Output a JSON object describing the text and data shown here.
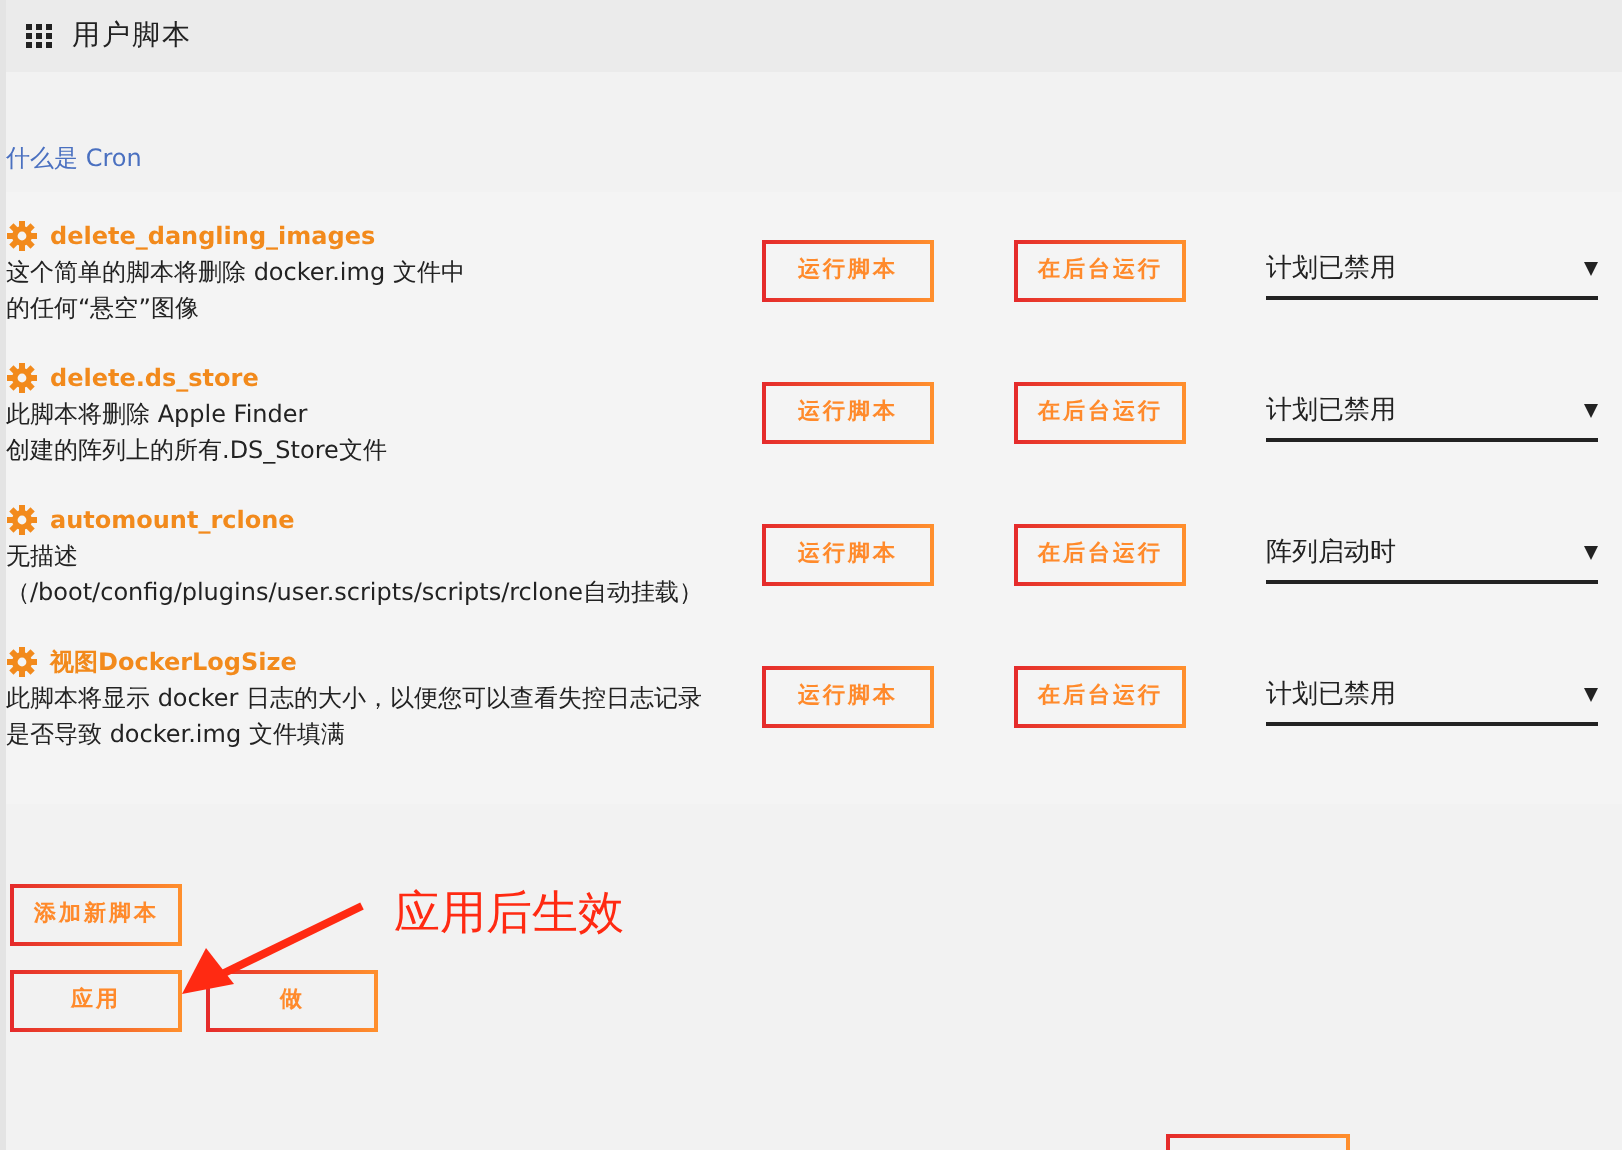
{
  "header": {
    "title": "用户脚本"
  },
  "help_link": "什么是 Cron",
  "scripts": [
    {
      "name": "delete_dangling_images",
      "description": [
        "这个简单的脚本将删除 docker.img 文件中",
        "的任何“悬空”图像"
      ],
      "run_label": "运行脚本",
      "background_label": "在后台运行",
      "schedule": "计划已禁用"
    },
    {
      "name": "delete.ds_store",
      "description": [
        "此脚本将删除 Apple Finder",
        "创建的阵列上的所有.DS_Store文件"
      ],
      "run_label": "运行脚本",
      "background_label": "在后台运行",
      "schedule": "计划已禁用"
    },
    {
      "name": "automount_rclone",
      "description": [
        "无描述",
        "（/boot/config/plugins/user.scripts/scripts/rclone自动挂载）"
      ],
      "run_label": "运行脚本",
      "background_label": "在后台运行",
      "schedule": "阵列启动时"
    },
    {
      "name": "视图DockerLogSize",
      "description": [
        "此脚本将显示 docker 日志的大小，以便您可以查看失控日志记录",
        "是否导致 docker.img 文件填满"
      ],
      "run_label": "运行脚本",
      "background_label": "在后台运行",
      "schedule": "计划已禁用"
    }
  ],
  "add_button": "添加新脚本",
  "buttons": [
    "应用",
    "做"
  ],
  "annotation": {
    "text": "应用后生效"
  }
}
